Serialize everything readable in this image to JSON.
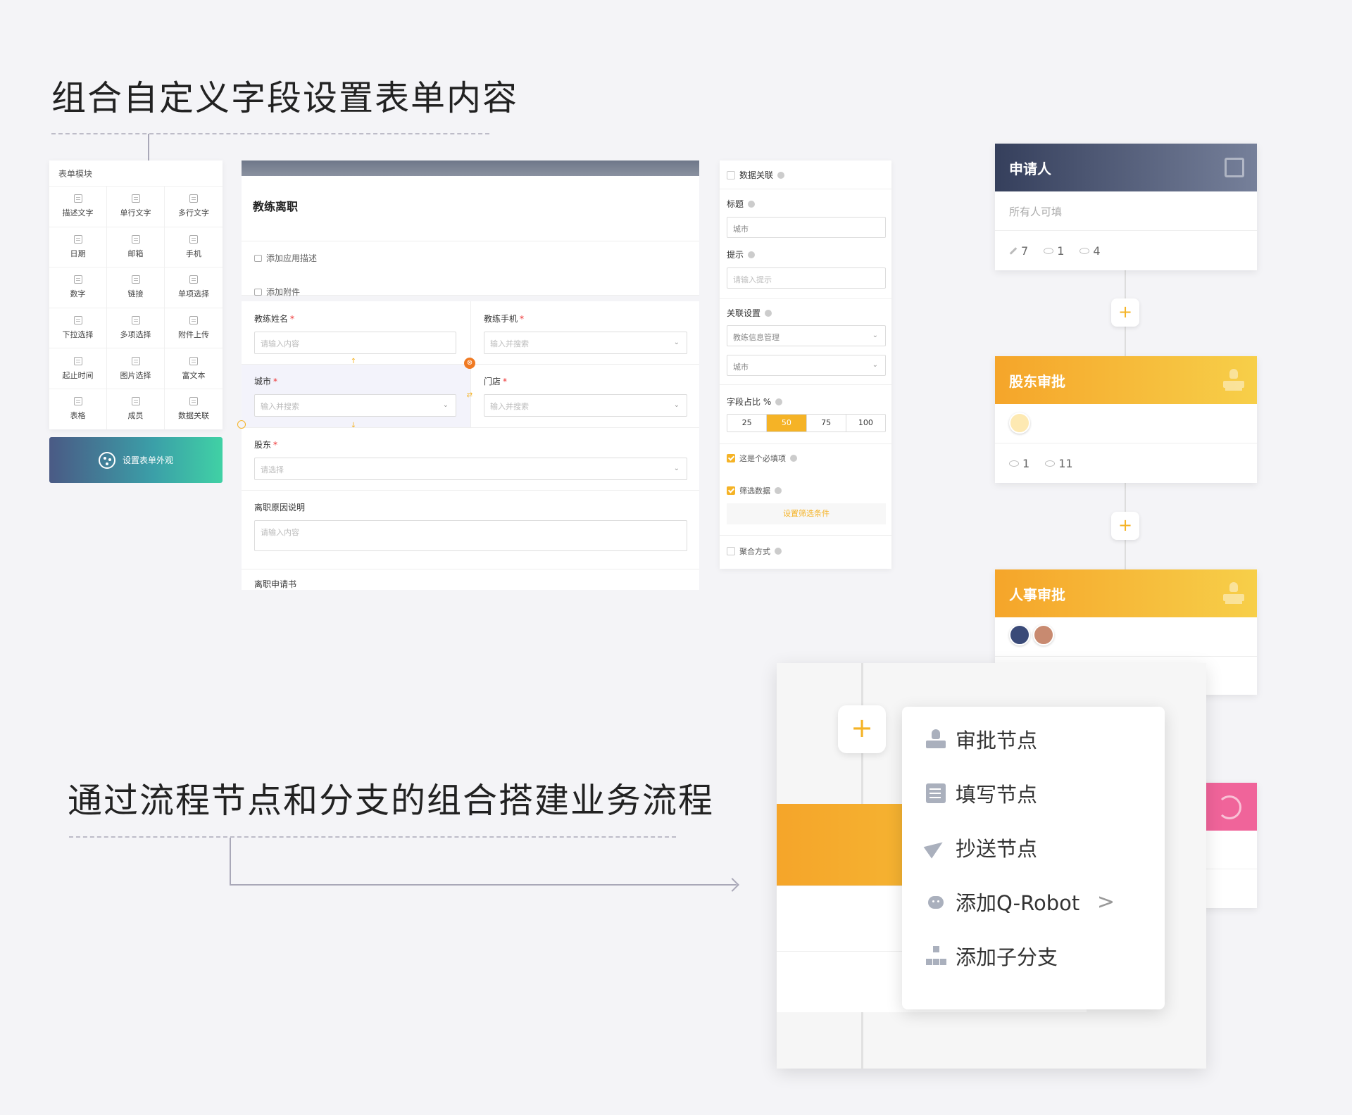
{
  "headings": {
    "top": "组合自定义字段设置表单内容",
    "bottom": "通过流程节点和分支的组合搭建业务流程"
  },
  "palette": {
    "title": "表单模块",
    "items": [
      {
        "label": "描述文字",
        "icon": "text-icon"
      },
      {
        "label": "单行文字",
        "icon": "single-line-icon"
      },
      {
        "label": "多行文字",
        "icon": "multi-line-icon"
      },
      {
        "label": "日期",
        "icon": "date-icon"
      },
      {
        "label": "邮箱",
        "icon": "email-icon"
      },
      {
        "label": "手机",
        "icon": "phone-icon"
      },
      {
        "label": "数字",
        "icon": "number-icon"
      },
      {
        "label": "链接",
        "icon": "link-icon"
      },
      {
        "label": "单项选择",
        "icon": "radio-icon"
      },
      {
        "label": "下拉选择",
        "icon": "dropdown-icon"
      },
      {
        "label": "多项选择",
        "icon": "checkbox-icon"
      },
      {
        "label": "附件上传",
        "icon": "attachment-icon"
      },
      {
        "label": "起止时间",
        "icon": "time-range-icon"
      },
      {
        "label": "图片选择",
        "icon": "image-icon"
      },
      {
        "label": "富文本",
        "icon": "rich-text-icon"
      },
      {
        "label": "表格",
        "icon": "table-icon"
      },
      {
        "label": "成员",
        "icon": "member-icon"
      },
      {
        "label": "数据关联",
        "icon": "data-link-icon"
      }
    ],
    "appearance_button": "设置表单外观"
  },
  "form": {
    "title": "教练离职",
    "add_description": "添加应用描述",
    "add_attachment": "添加附件",
    "fields": {
      "coach_name": {
        "label": "教练姓名",
        "placeholder": "请输入内容"
      },
      "coach_phone": {
        "label": "教练手机",
        "placeholder": "输入并搜索"
      },
      "city": {
        "label": "城市",
        "placeholder": "输入并搜索"
      },
      "store": {
        "label": "门店",
        "placeholder": "输入并搜索"
      },
      "shareholder": {
        "label": "股东",
        "placeholder": "请选择"
      },
      "reason": {
        "label": "离职原因说明",
        "placeholder": "请输入内容"
      },
      "application": {
        "label": "离职申请书"
      }
    },
    "required_mark": "*"
  },
  "properties": {
    "data_link": "数据关联",
    "title_label": "标题",
    "title_value": "城市",
    "hint_label": "提示",
    "hint_placeholder": "请输入提示",
    "link_settings": "关联设置",
    "link_source": "教练信息管理",
    "link_field": "城市",
    "width_label": "字段占比 %",
    "width_options": [
      "25",
      "50",
      "75",
      "100"
    ],
    "width_selected": "50",
    "required_label": "这是个必填项",
    "required_checked": true,
    "filter_label": "筛选数据",
    "filter_checked": true,
    "filter_button": "设置筛选条件",
    "aggregate_label": "聚合方式",
    "aggregate_checked": false
  },
  "flow": {
    "applicant": {
      "title": "申请人",
      "sub": "所有人可填",
      "edit_count": "7",
      "hidden_count": "1",
      "view_count": "4"
    },
    "shareholder_approval": {
      "title": "股东审批",
      "hidden_count": "1",
      "view_count": "11"
    },
    "hr_approval": {
      "title": "人事审批"
    },
    "add": "+"
  },
  "menu": {
    "items": [
      {
        "label": "审批节点",
        "icon": "approval-stamp-icon"
      },
      {
        "label": "填写节点",
        "icon": "form-fill-icon"
      },
      {
        "label": "抄送节点",
        "icon": "send-icon"
      },
      {
        "label": "添加Q-Robot",
        "icon": "robot-icon",
        "submenu_marker": ">"
      },
      {
        "label": "添加子分支",
        "icon": "branch-icon"
      }
    ]
  },
  "colors": {
    "accent": "#f5b326",
    "dark_header": "#353f5c",
    "pink": "#f0649a",
    "required": "#ee3333"
  }
}
